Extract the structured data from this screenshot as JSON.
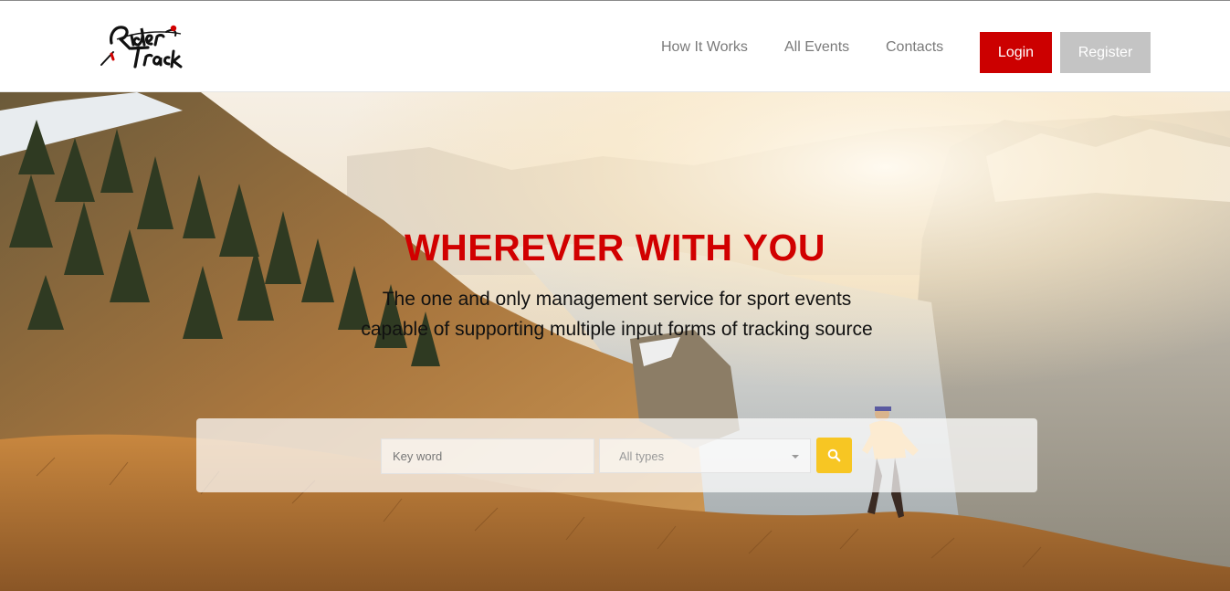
{
  "brand": {
    "logo_alt": "RiderTrack"
  },
  "nav": {
    "items": [
      {
        "label": "How It Works"
      },
      {
        "label": "All Events"
      },
      {
        "label": "Contacts"
      }
    ],
    "login_label": "Login",
    "register_label": "Register"
  },
  "hero": {
    "title": "WHEREVER WITH YOU",
    "subtitle_line1": "The one and only management service for sport events",
    "subtitle_line2": "capable of supporting multiple input forms of tracking source"
  },
  "search": {
    "keyword_placeholder": "Key word",
    "keyword_value": "",
    "type_selected": "All types",
    "button_icon": "search-icon"
  },
  "colors": {
    "accent_red": "#cc0000",
    "title_red": "#d10000",
    "register_gray": "#c4c4c4",
    "search_yellow": "#f7c623"
  }
}
